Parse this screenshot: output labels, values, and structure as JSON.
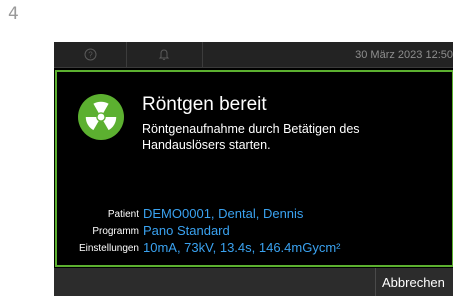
{
  "step_number": "4",
  "statusbar": {
    "help_icon": "question-circle-icon",
    "bell_icon": "bell-icon",
    "datetime": "30 März 2023  12:50"
  },
  "dialog": {
    "icon": "radiation-icon",
    "title": "Röntgen bereit",
    "message": "Röntgenaufnahme durch Betätigen des Handauslösers starten.",
    "info": {
      "patient_label": "Patient",
      "patient_value": "DEMO0001, Dental, Dennis",
      "program_label": "Programm",
      "program_value": "Pano Standard",
      "settings_label": "Einstellungen",
      "settings_value": "10mA, 73kV, 13.4s, 146.4mGycm²"
    }
  },
  "footer": {
    "cancel_label": "Abbrechen"
  },
  "colors": {
    "accent_green": "#5cb030",
    "value_blue": "#3aa2f0"
  }
}
